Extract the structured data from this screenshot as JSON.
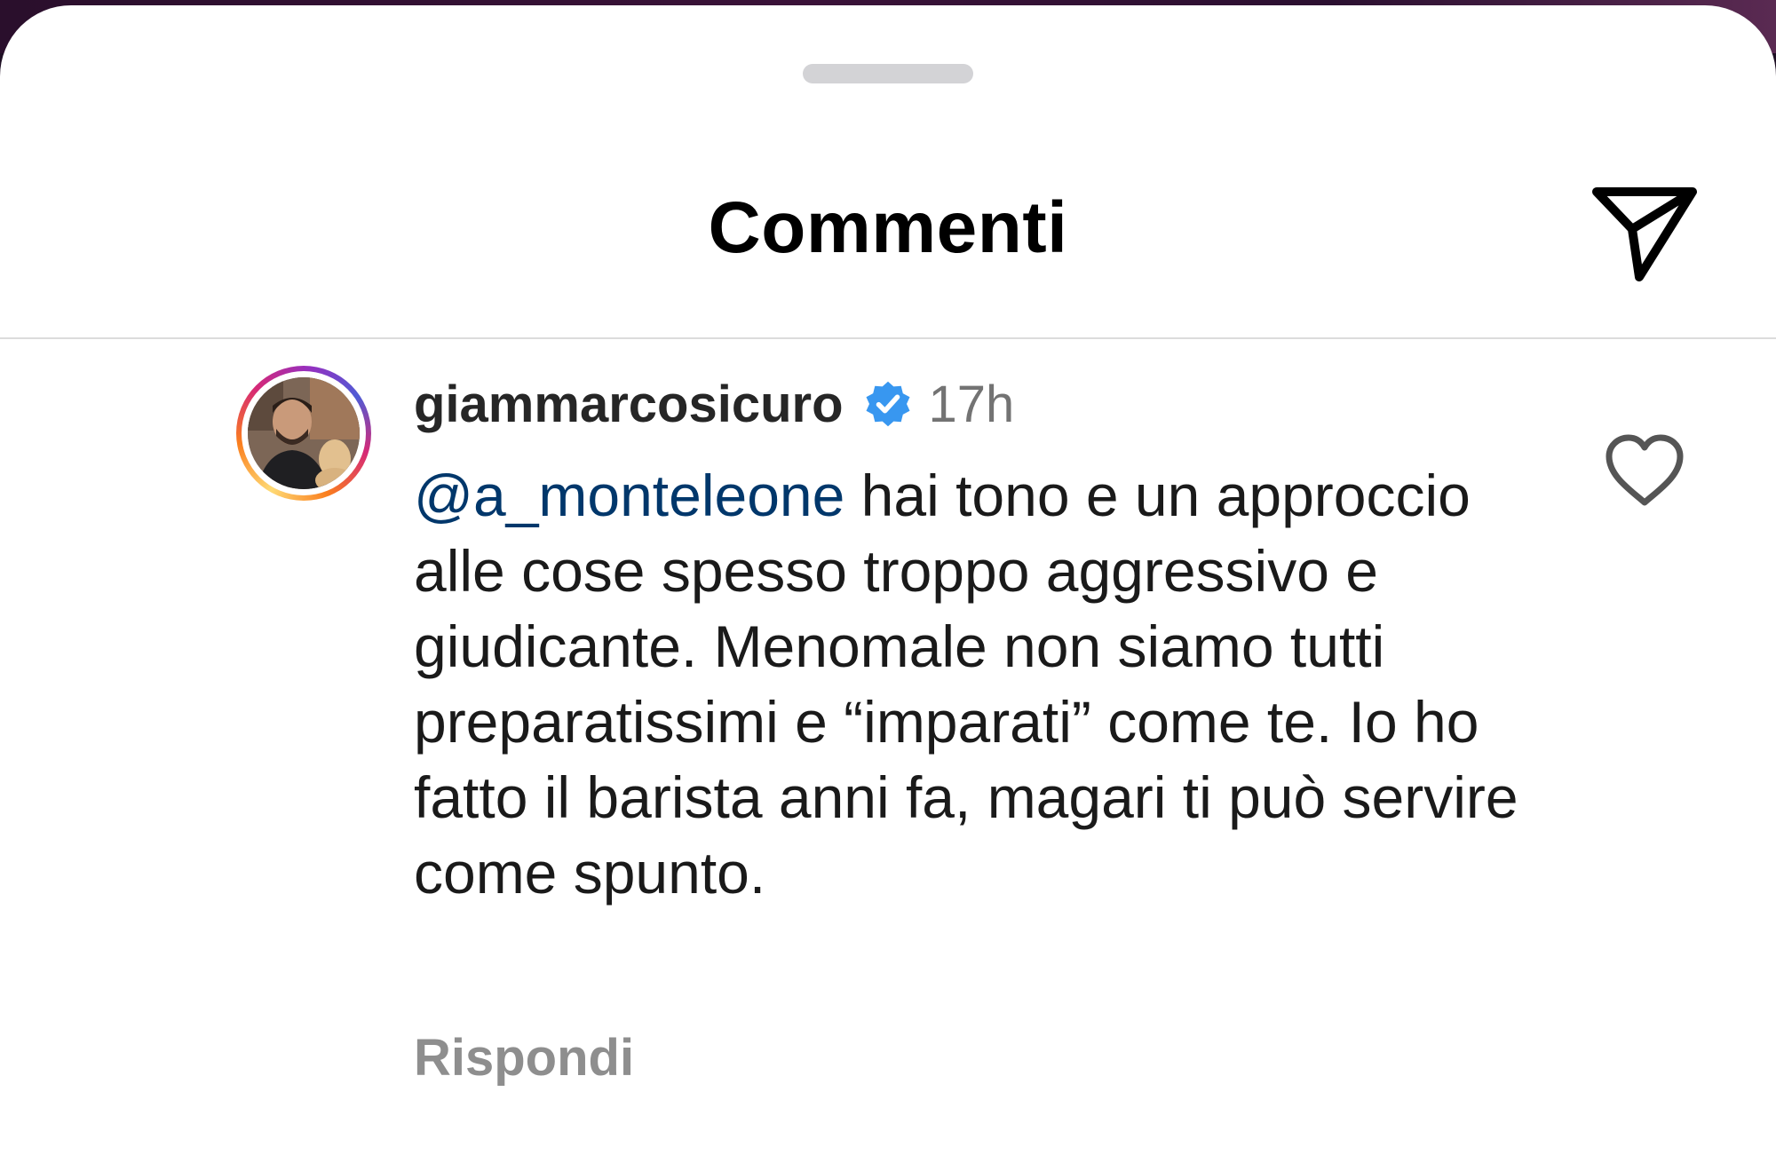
{
  "header": {
    "title": "Commenti",
    "share_icon": "paper-plane-icon"
  },
  "comment": {
    "username": "giammarcosicuro",
    "verified_icon": "verified-badge-icon",
    "timestamp": "17h",
    "mention": "@a_monteleone",
    "text": " hai tono e un approccio alle cose spesso troppo aggressivo e giudicante. Menomale non siamo tutti preparatissimi e “imparati” come te. Io ho fatto il barista anni fa, magari ti può servire come spunto.",
    "reply_label": "Rispondi",
    "like_icon": "heart-icon"
  },
  "colors": {
    "mention": "#00376b",
    "verified": "#3897f0",
    "muted": "#737373"
  }
}
